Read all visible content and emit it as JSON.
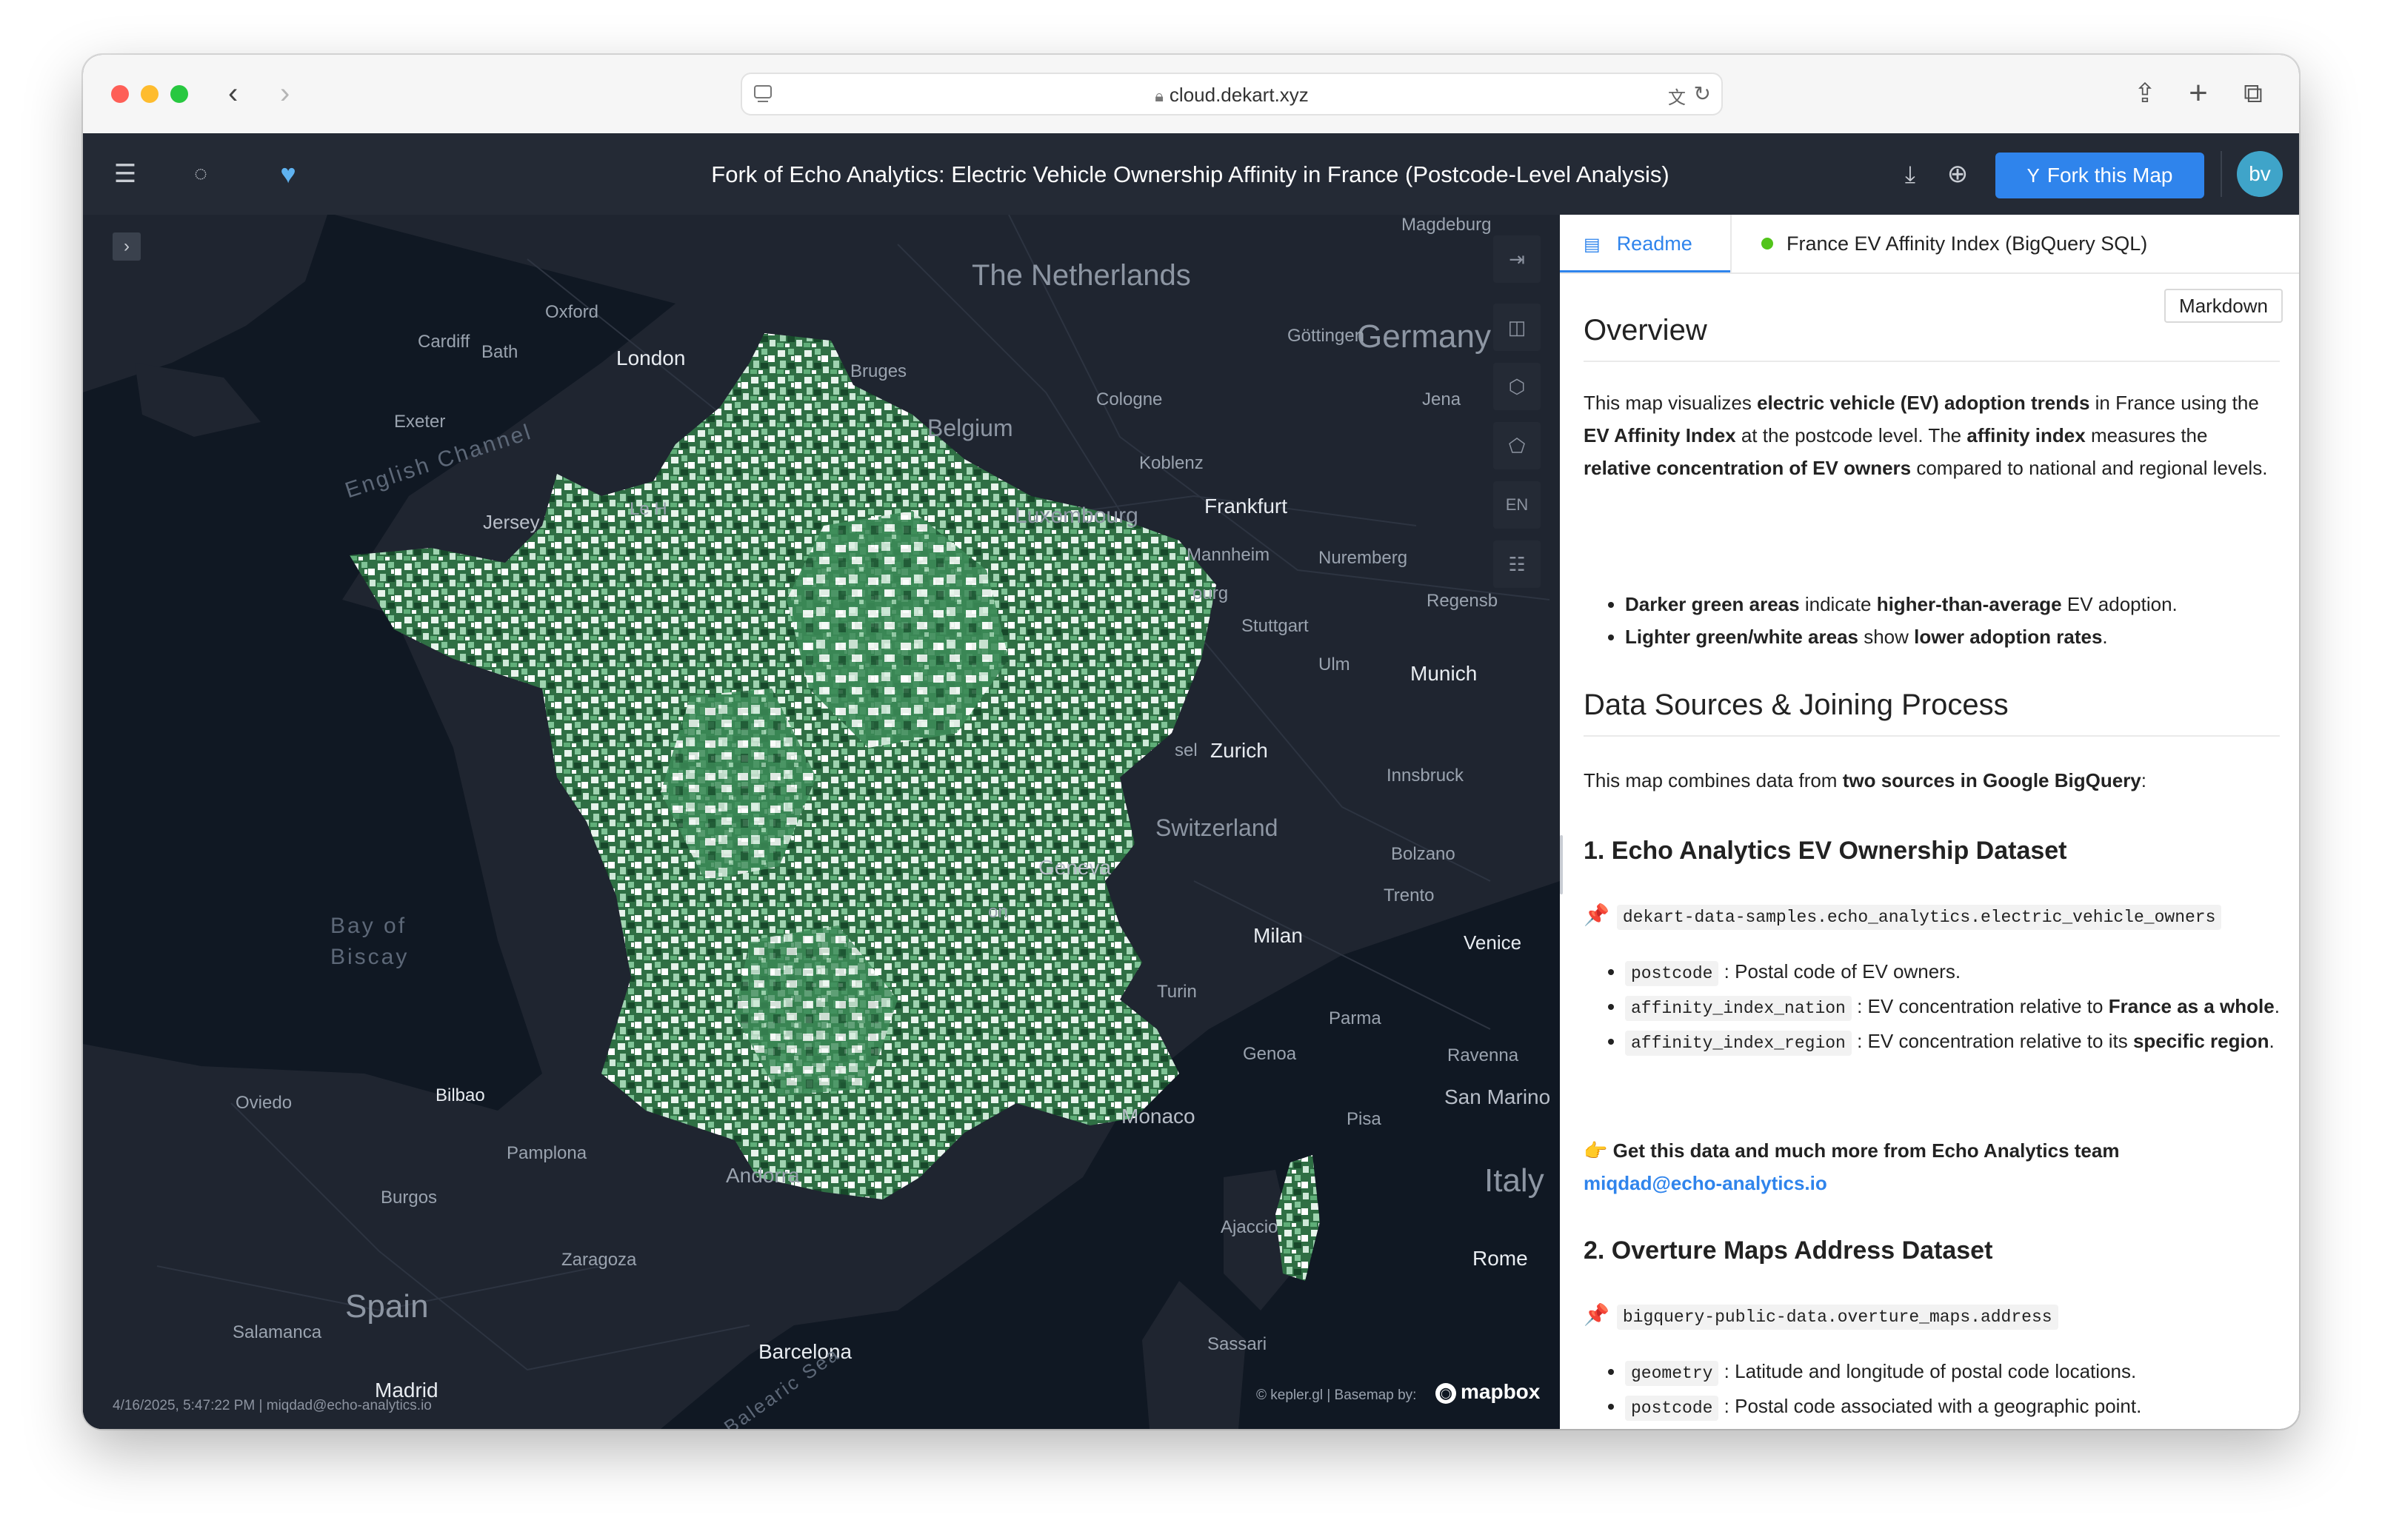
{
  "browser": {
    "url": "cloud.dekart.xyz"
  },
  "header": {
    "title": "Fork of Echo Analytics: Electric Vehicle Ownership Affinity in France (Postcode-Level Analysis)",
    "fork_label": "Fork this Map",
    "avatar_initials": "bv",
    "accent_color": "#2f84ec"
  },
  "map": {
    "countries": [
      "The Netherlands",
      "Germany",
      "Belgium",
      "Luxembourg",
      "Switzerland",
      "Spain",
      "Italy"
    ],
    "cities": {
      "london": "London",
      "frankfurt": "Frankfurt",
      "munich": "Munich",
      "zurich": "Zurich",
      "milan": "Milan",
      "venice": "Venice",
      "monaco": "Monaco",
      "barcelona": "Barcelona",
      "bilbao": "Bilbao",
      "madrid": "Madrid",
      "rome": "Rome",
      "geneva": "Geneva"
    },
    "towns": {
      "oxford": "Oxford",
      "cardiff": "Cardiff",
      "bath": "Bath",
      "exeter": "Exeter",
      "bruges": "Bruges",
      "cologne": "Cologne",
      "koblenz": "Koblenz",
      "gottingen": "Göttingen",
      "jena": "Jena",
      "mannheim": "Mannheim",
      "nuremberg": "Nuremberg",
      "regensburg": "Regensb",
      "stuttgart": "Stuttgart",
      "ulm": "Ulm",
      "innsbruck": "Innsbruck",
      "bolzano": "Bolzano",
      "trento": "Trento",
      "turin": "Turin",
      "genoa": "Genoa",
      "parma": "Parma",
      "ravenna": "Ravenna",
      "san_marino": "San Marino",
      "pisa": "Pisa",
      "oviedo": "Oviedo",
      "pamplona": "Pamplona",
      "burgos": "Burgos",
      "zaragoza": "Zaragoza",
      "salamanca": "Salamanca",
      "ajaccio": "Ajaccio",
      "sassari": "Sassari",
      "jersey": "Jersey",
      "le_havre": "Le H",
      "andorra": "Andorra",
      "magdeburg": "Magdeburg",
      "lyon": "on",
      "basel": "sel",
      "strasbourg": "ourg"
    },
    "waters": {
      "channel": "English Channel",
      "biscay_1": "Bay of",
      "biscay_2": "Biscay",
      "balearic": "Balearic Sea"
    },
    "controls": {
      "lang": "EN"
    },
    "attribution": "© kepler.gl | Basemap by:",
    "basemap_brand": "mapbox",
    "footer": "4/16/2025, 5:47:22 PM | miqdad@echo-analytics.io",
    "ev_colors": [
      "#ffffff",
      "#d8eee0",
      "#9fd3b0",
      "#5fae78",
      "#2f7a45",
      "#17482a"
    ]
  },
  "panel": {
    "tabs": [
      "Readme",
      "France EV Affinity Index (BigQuery SQL)"
    ],
    "markdown_btn": "Markdown",
    "overview_title": "Overview",
    "data_sources_title": "Data Sources & Joining Process",
    "data_intro_a": "This map combines data from ",
    "data_intro_b": "two sources in Google BigQuery",
    "data_intro_c": ":",
    "ds1_title": "1. Echo Analytics EV Ownership Dataset",
    "ds1_table": "dekart-data-samples.echo_analytics.electric_vehicle_owners",
    "ds1_fields": {
      "postcode_name": "postcode",
      "postcode_desc": ": Postal code of EV owners.",
      "nation_name": "affinity_index_nation",
      "nation_desc": ": EV concentration relative to ",
      "nation_bold": "France as a whole",
      "region_name": "affinity_index_region",
      "region_desc": ": EV concentration relative to its ",
      "region_bold": "specific region"
    },
    "cta_text": "Get this data and much more from Echo Analytics team",
    "cta_email": "miqdad@echo-analytics.io",
    "ds2_title": "2. Overture Maps Address Dataset",
    "ds2_table": "bigquery-public-data.overture_maps.address",
    "ds2_fields": {
      "geometry_name": "geometry",
      "geometry_desc": ": Latitude and longitude of postal code locations.",
      "postcode_name": "postcode",
      "postcode_desc": ": Postal code associated with a geographic point."
    }
  }
}
